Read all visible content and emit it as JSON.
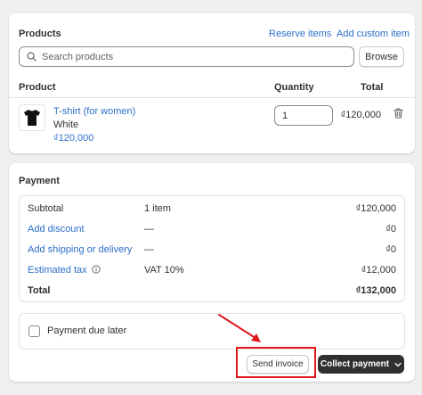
{
  "products": {
    "title": "Products",
    "reserve_items": "Reserve items",
    "add_custom_item": "Add custom item",
    "search_placeholder": "Search products",
    "browse_label": "Browse",
    "columns": {
      "product": "Product",
      "quantity": "Quantity",
      "total": "Total"
    },
    "items": [
      {
        "name": "T-shirt (for women)",
        "variant": "White",
        "price": "₫120,000",
        "quantity": "1",
        "line_total": "₫120,000"
      }
    ]
  },
  "payment": {
    "title": "Payment",
    "rows": [
      {
        "label": "Subtotal",
        "mid": "1 item",
        "amount": "₫120,000"
      },
      {
        "label": "Add discount",
        "mid": "—",
        "amount": "₫0"
      },
      {
        "label": "Add shipping or delivery",
        "mid": "—",
        "amount": "₫0"
      },
      {
        "label": "Estimated tax",
        "mid": "VAT 10%",
        "amount": "₫12,000"
      },
      {
        "label": "Total",
        "mid": "",
        "amount": "₫132,000"
      }
    ],
    "payment_due_later": "Payment due later",
    "send_invoice": "Send invoice",
    "collect_payment": "Collect payment"
  },
  "colors": {
    "link": "#2c6ecb",
    "primary_button": "#303030",
    "annotation": "#e0181b"
  }
}
